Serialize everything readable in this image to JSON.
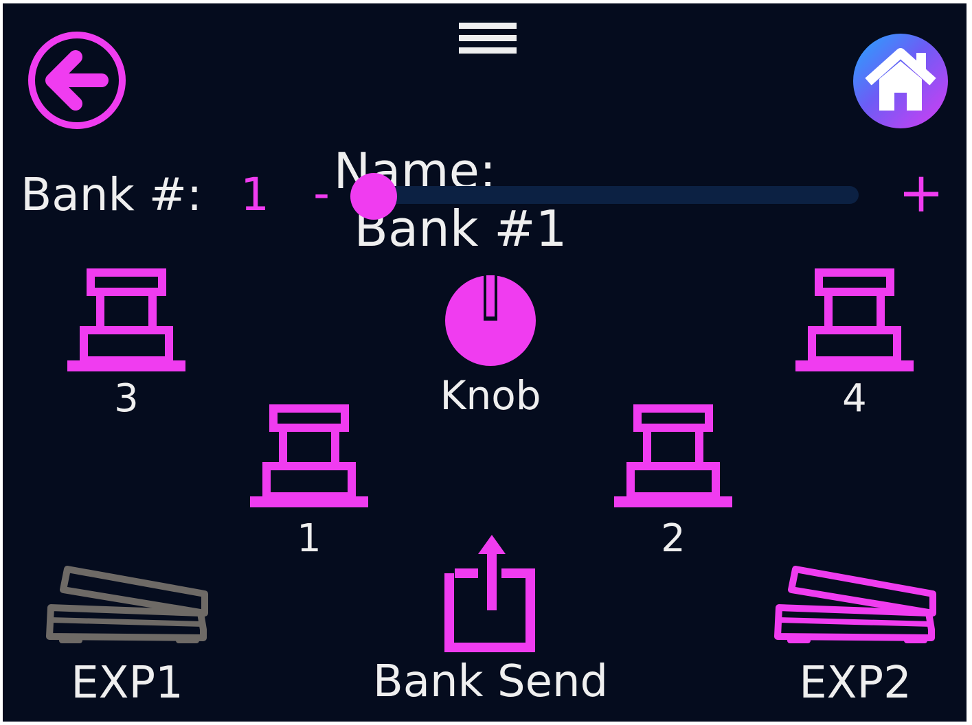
{
  "header": {
    "name_label": "Name:",
    "name_value": "Bank #1",
    "back_icon": "arrow-left-circle-icon",
    "menu_icon": "hamburger-menu-icon",
    "home_icon": "home-icon"
  },
  "bank": {
    "label": "Bank #:",
    "value": "1",
    "minus_label": "-",
    "plus_label": "+",
    "slider_fraction": 0.0
  },
  "controls": {
    "footswitch_3": "3",
    "footswitch_4": "4",
    "footswitch_1": "1",
    "footswitch_2": "2",
    "knob": "Knob",
    "bank_send": "Bank Send",
    "exp1": "EXP1",
    "exp2": "EXP2"
  },
  "colors": {
    "background": "#050c1e",
    "accent": "#f03cf0",
    "text": "#efefef",
    "inactive": "#6e6a66",
    "slider_track": "#0c2143"
  }
}
